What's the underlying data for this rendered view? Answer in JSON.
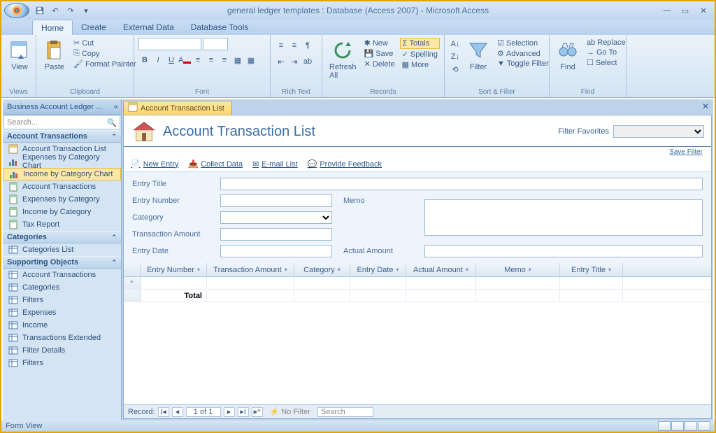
{
  "titlebar": {
    "title": "general ledger templates : Database (Access 2007) - Microsoft Access"
  },
  "menutabs": [
    "Home",
    "Create",
    "External Data",
    "Database Tools"
  ],
  "ribbon": {
    "views": {
      "label": "Views",
      "btn": "View"
    },
    "clipboard": {
      "label": "Clipboard",
      "paste": "Paste",
      "cut": "Cut",
      "copy": "Copy",
      "painter": "Format Painter"
    },
    "font": {
      "label": "Font"
    },
    "richtext": {
      "label": "Rich Text"
    },
    "records": {
      "label": "Records",
      "refresh": "Refresh All",
      "new": "New",
      "save": "Save",
      "delete": "Delete",
      "totals": "Totals",
      "spelling": "Spelling",
      "more": "More"
    },
    "sortfilter": {
      "label": "Sort & Filter",
      "filter": "Filter",
      "selection": "Selection",
      "advanced": "Advanced",
      "toggle": "Toggle Filter"
    },
    "find": {
      "label": "Find",
      "find": "Find",
      "replace": "Replace",
      "goto": "Go To",
      "select": "Select"
    }
  },
  "navpane": {
    "header": "Business Account Ledger ...",
    "search_placeholder": "Search...",
    "sections": [
      {
        "name": "Account Transactions",
        "items": [
          {
            "icon": "form",
            "label": "Account Transaction List"
          },
          {
            "icon": "chart",
            "label": "Expenses by Category Chart"
          },
          {
            "icon": "chart",
            "label": "Income by Category Chart",
            "selected": true
          },
          {
            "icon": "report",
            "label": "Account Transactions"
          },
          {
            "icon": "report",
            "label": "Expenses by Category"
          },
          {
            "icon": "report",
            "label": "Income by Category"
          },
          {
            "icon": "report",
            "label": "Tax Report"
          }
        ]
      },
      {
        "name": "Categories",
        "items": [
          {
            "icon": "table",
            "label": "Categories List"
          }
        ]
      },
      {
        "name": "Supporting Objects",
        "items": [
          {
            "icon": "table",
            "label": "Account Transactions"
          },
          {
            "icon": "table",
            "label": "Categories"
          },
          {
            "icon": "table",
            "label": "Filters"
          },
          {
            "icon": "table",
            "label": "Expenses"
          },
          {
            "icon": "table",
            "label": "Income"
          },
          {
            "icon": "table",
            "label": "Transactions Extended"
          },
          {
            "icon": "table",
            "label": "Filter Details"
          },
          {
            "icon": "table",
            "label": "Filters"
          }
        ]
      }
    ]
  },
  "doc": {
    "tab_label": "Account Transaction List",
    "title": "Account Transaction List",
    "filter_favorites_label": "Filter Favorites",
    "save_filter": "Save Filter",
    "actions": {
      "new": "New Entry",
      "collect": "Collect Data",
      "email": "E-mail List",
      "feedback": "Provide Feedback"
    },
    "form": {
      "entry_title": "Entry Title",
      "entry_number": "Entry Number",
      "category": "Category",
      "transaction_amount": "Transaction Amount",
      "entry_date": "Entry Date",
      "memo": "Memo",
      "actual_amount": "Actual Amount"
    },
    "grid_headers": [
      "Entry Number",
      "Transaction Amount",
      "Category",
      "Entry Date",
      "Actual Amount",
      "Memo",
      "Entry Title"
    ],
    "total_label": "Total"
  },
  "record_nav": {
    "label": "Record:",
    "position": "1 of 1",
    "nofilter": "No Filter",
    "search": "Search"
  },
  "statusbar": {
    "text": "Form View"
  }
}
